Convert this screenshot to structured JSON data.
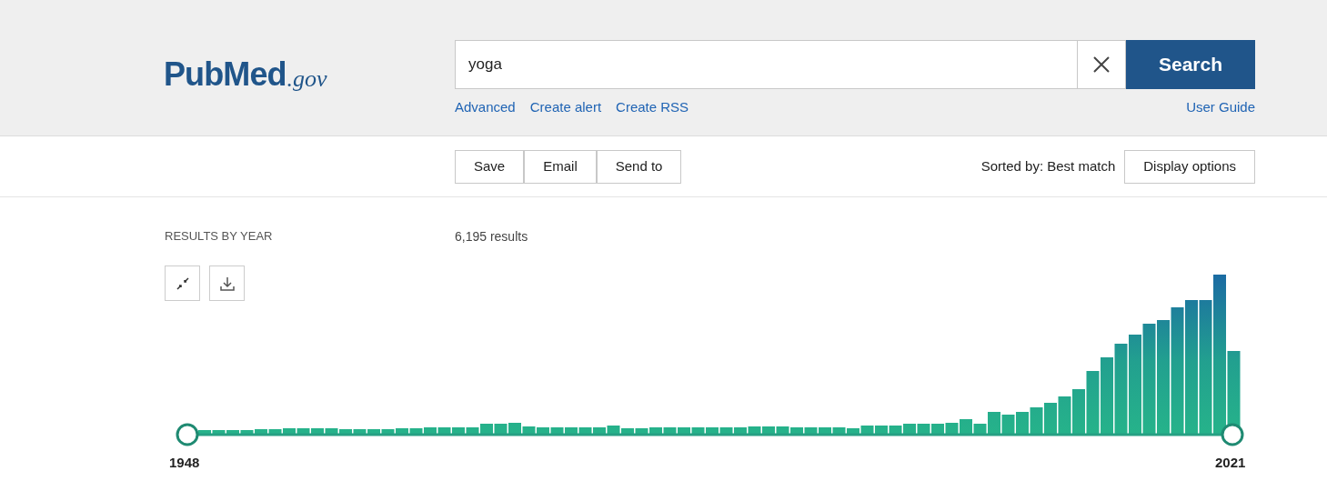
{
  "logo": {
    "name": "PubMed",
    "suffix": ".gov"
  },
  "search": {
    "value": "yoga",
    "button": "Search"
  },
  "search_links": [
    {
      "label": "Advanced"
    },
    {
      "label": "Create alert"
    },
    {
      "label": "Create RSS"
    }
  ],
  "user_guide": "User Guide",
  "actions": [
    {
      "label": "Save"
    },
    {
      "label": "Email"
    },
    {
      "label": "Send to"
    }
  ],
  "sort": {
    "label": "Sorted by: Best match"
  },
  "display_options": "Display options",
  "results_by_year": {
    "title": "RESULTS BY YEAR",
    "range_start": "1948",
    "range_end": "2021"
  },
  "results_count": "6,195 results"
}
